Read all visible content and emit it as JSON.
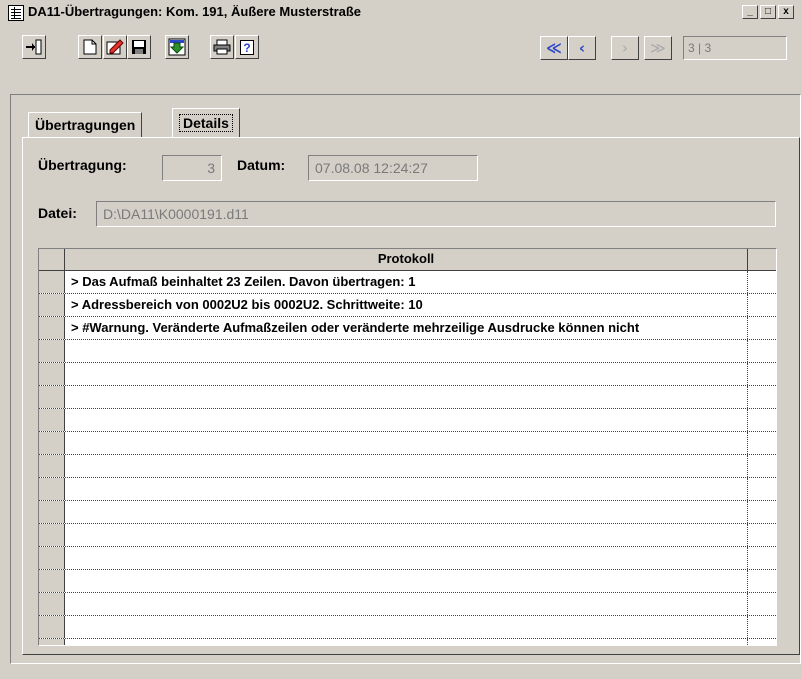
{
  "window": {
    "title": "DA11-Übertragungen: Kom. 191, Äußere Musterstraße"
  },
  "title_buttons": [
    "_",
    "□",
    "x"
  ],
  "toolbar": {
    "buttons": [
      "exit-icon",
      "new-document-icon",
      "edit-document-icon",
      "save-disk-icon",
      "import-icon",
      "print-icon",
      "help-icon"
    ],
    "help_label": "?"
  },
  "navigation": {
    "first": "≪",
    "prev": "‹",
    "next": "›",
    "last": "≫",
    "record": "3 | 3"
  },
  "tabs": [
    {
      "label": "Übertragungen",
      "active": false
    },
    {
      "label": "Details",
      "active": true
    }
  ],
  "details": {
    "uebertragung_label": "Übertragung:",
    "uebertragung_value": "3",
    "datum_label": "Datum:",
    "datum_value": "07.08.08 12:24:27",
    "datei_label": "Datei:",
    "datei_value": "D:\\DA11\\K0000191.d11"
  },
  "grid": {
    "header": "Protokoll",
    "rows": [
      "> Das Aufmaß beinhaltet 23 Zeilen. Davon übertragen: 1",
      "> Adressbereich von 0002U2 bis 0002U2. Schrittweite: 10",
      "> #Warnung. Veränderte Aufmaßzeilen oder veränderte mehrzeilige Ausdrucke können nicht",
      "",
      "",
      "",
      "",
      "",
      "",
      "",
      "",
      "",
      "",
      "",
      "",
      "",
      ""
    ]
  },
  "colors": {
    "face": "#d4d0c8",
    "shadow": "#808080",
    "highlight": "#ffffff",
    "nav_active": "#2b46c8",
    "save_accent": "#e0352b",
    "import_accent": "#2f8f2f"
  }
}
